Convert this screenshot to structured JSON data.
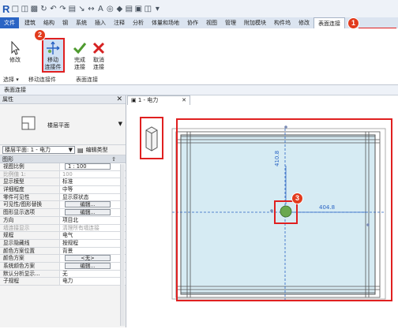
{
  "qat": {
    "logo": "R"
  },
  "tabs": [
    "文件",
    "建筑",
    "结构",
    "钢",
    "系统",
    "插入",
    "注释",
    "分析",
    "体量和场地",
    "协作",
    "视图",
    "管理",
    "附加模块",
    "构件坞",
    "修改",
    "表面连接"
  ],
  "ribbon": {
    "modify": "修改",
    "move_connector_line1": "移动",
    "move_connector_line2": "连接件",
    "finish_line1": "完成",
    "finish_line2": "连接",
    "cancel_line1": "取消",
    "cancel_line2": "连接",
    "panel_select": "选择",
    "panel_move_connector": "移动连接件",
    "panel_surface_connect": "表面连接"
  },
  "options_bar": "表面连接",
  "properties": {
    "title": "属性",
    "type_name": "楼层平面",
    "selector": "楼层平面: 1 - 电力",
    "edit_type": "编辑类型",
    "group_graphics": "图形",
    "rows": [
      {
        "name": "视图比例",
        "value": "1 : 100",
        "kind": "box"
      },
      {
        "name": "比例值 1:",
        "value": "100",
        "kind": "grey"
      },
      {
        "name": "显示模型",
        "value": "标准",
        "kind": "text"
      },
      {
        "name": "详细程度",
        "value": "中等",
        "kind": "text"
      },
      {
        "name": "零件可见性",
        "value": "显示原状态",
        "kind": "text"
      },
      {
        "name": "可见性/图形替换",
        "value": "编辑...",
        "kind": "button"
      },
      {
        "name": "图形显示选项",
        "value": "编辑...",
        "kind": "button"
      },
      {
        "name": "方向",
        "value": "项目北",
        "kind": "text"
      },
      {
        "name": "墙连接显示",
        "value": "清理所有墙连接",
        "kind": "grey"
      },
      {
        "name": "规程",
        "value": "电气",
        "kind": "text"
      },
      {
        "name": "显示隐藏线",
        "value": "按规程",
        "kind": "text"
      },
      {
        "name": "颜色方案位置",
        "value": "背景",
        "kind": "text"
      },
      {
        "name": "颜色方案",
        "value": "<无>",
        "kind": "button"
      },
      {
        "name": "系统颜色方案",
        "value": "编辑...",
        "kind": "button"
      },
      {
        "name": "默认分析显示...",
        "value": "无",
        "kind": "text"
      },
      {
        "name": "子规程",
        "value": "电力",
        "kind": "text"
      }
    ]
  },
  "view_tab": "1 - 电力",
  "dims": {
    "vertical": "410.8",
    "horizontal": "404.8"
  },
  "badges": [
    "1",
    "2",
    "3"
  ],
  "colors": {
    "accent": "#2a64c4",
    "highlight": "#e02020",
    "badge": "#e23b1d",
    "connector": "#6aa84f",
    "floor_fill": "#d6ebf3"
  }
}
